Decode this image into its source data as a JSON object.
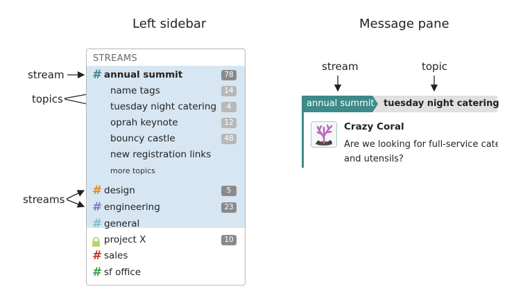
{
  "headings": {
    "left": "Left sidebar",
    "right": "Message pane"
  },
  "annotations": {
    "stream_left": "stream",
    "topics": "topics",
    "streams": "streams",
    "stream_right": "stream",
    "topic": "topic"
  },
  "sidebar": {
    "header": "STREAMS",
    "active_stream": {
      "name": "annual summit",
      "count": "78",
      "color": "#3e8a8a",
      "topics": [
        {
          "name": "name tags",
          "count": "14"
        },
        {
          "name": "tuesday night catering",
          "count": "4"
        },
        {
          "name": "oprah keynote",
          "count": "12"
        },
        {
          "name": "bouncy castle",
          "count": "48"
        },
        {
          "name": "new registration links",
          "count": ""
        }
      ],
      "more_topics": "more topics"
    },
    "streams": [
      {
        "name": "design",
        "count": "5",
        "color": "#e08a2e",
        "icon": "hash-icon"
      },
      {
        "name": "engineering",
        "count": "23",
        "color": "#7b7fc0",
        "icon": "hash-icon"
      },
      {
        "name": "general",
        "count": "",
        "color": "#7fc4c4",
        "icon": "hash-icon"
      },
      {
        "name": "project X",
        "count": "10",
        "color": "#b8d66a",
        "icon": "lock-icon"
      },
      {
        "name": "sales",
        "count": "",
        "color": "#c0392b",
        "icon": "hash-icon"
      },
      {
        "name": "sf office",
        "count": "",
        "color": "#3fa34d",
        "icon": "hash-icon"
      }
    ]
  },
  "message_pane": {
    "stream": "annual summit",
    "topic": "tuesday night catering",
    "sender": "Crazy Coral",
    "text_line1": "Are we looking for full-service cateri",
    "text_line2": "and utensils?",
    "accent_color": "#3e8a8a"
  }
}
